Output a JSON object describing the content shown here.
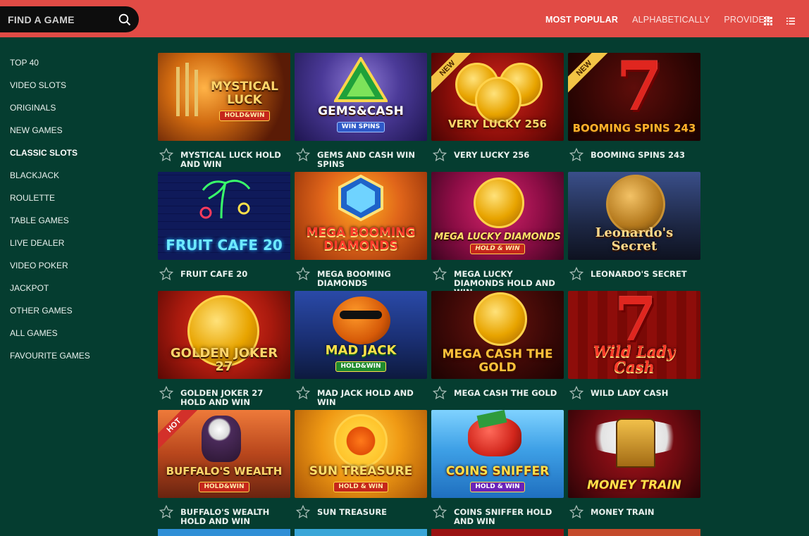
{
  "header": {
    "search_placeholder": "FIND A GAME",
    "sort_tabs": [
      "MOST POPULAR",
      "ALPHABETICALLY",
      "PROVIDER"
    ],
    "active_sort": "MOST POPULAR",
    "view_icons": [
      "grid-view-icon",
      "list-view-icon"
    ]
  },
  "sidebar": {
    "items": [
      "TOP 40",
      "VIDEO SLOTS",
      "ORIGINALS",
      "NEW GAMES",
      "CLASSIC SLOTS",
      "BLACKJACK",
      "ROULETTE",
      "TABLE GAMES",
      "LIVE DEALER",
      "VIDEO POKER",
      "JACKPOT",
      "OTHER GAMES",
      "ALL GAMES",
      "FAVOURITE GAMES"
    ],
    "active": "CLASSIC SLOTS"
  },
  "games": [
    {
      "name": "MYSTICAL LUCK HOLD AND WIN",
      "thumb_title": "MYSTICAL LUCK",
      "thumb_sub": "HOLD&WIN",
      "badge": ""
    },
    {
      "name": "GEMS AND CASH WIN SPINS",
      "thumb_title": "GEMS&CASH",
      "thumb_sub": "WIN SPINS",
      "badge": ""
    },
    {
      "name": "VERY LUCKY 256",
      "thumb_title": "VERY LUCKY 256",
      "thumb_sub": "",
      "badge": "NEW"
    },
    {
      "name": "BOOMING SPINS 243",
      "thumb_title": "BOOMING SPINS 243",
      "thumb_sub": "",
      "badge": "NEW"
    },
    {
      "name": "FRUIT CAFE 20",
      "thumb_title": "FRUIT CAFE 20",
      "thumb_sub": "",
      "badge": ""
    },
    {
      "name": "MEGA BOOMING DIAMONDS",
      "thumb_title": "MEGA BOOMING DIAMONDS",
      "thumb_sub": "",
      "badge": ""
    },
    {
      "name": "MEGA LUCKY DIAMONDS HOLD AND WIN",
      "thumb_title": "MEGA LUCKY DIAMONDS",
      "thumb_sub": "HOLD & WIN",
      "badge": ""
    },
    {
      "name": "LEONARDO'S SECRET",
      "thumb_title": "Leonardo's Secret",
      "thumb_sub": "",
      "badge": ""
    },
    {
      "name": "GOLDEN JOKER 27 HOLD AND WIN",
      "thumb_title": "GOLDEN JOKER 27",
      "thumb_sub": "",
      "badge": ""
    },
    {
      "name": "MAD JACK HOLD AND WIN",
      "thumb_title": "MAD JACK",
      "thumb_sub": "HOLD&WIN",
      "badge": ""
    },
    {
      "name": "MEGA CASH THE GOLD",
      "thumb_title": "MEGA CASH THE GOLD",
      "thumb_sub": "",
      "badge": ""
    },
    {
      "name": "WILD LADY CASH",
      "thumb_title": "Wild Lady Cash",
      "thumb_sub": "",
      "badge": ""
    },
    {
      "name": "BUFFALO'S WEALTH HOLD AND WIN",
      "thumb_title": "BUFFALO'S WEALTH",
      "thumb_sub": "HOLD&WIN",
      "badge": "HOT"
    },
    {
      "name": "SUN TREASURE",
      "thumb_title": "SUN TREASURE",
      "thumb_sub": "HOLD & WIN",
      "badge": ""
    },
    {
      "name": "COINS SNIFFER HOLD AND WIN",
      "thumb_title": "COINS SNIFFER",
      "thumb_sub": "HOLD & WIN",
      "badge": ""
    },
    {
      "name": "MONEY TRAIN",
      "thumb_title": "MONEY TRAIN",
      "thumb_sub": "",
      "badge": ""
    }
  ],
  "colors": {
    "header_bg": "#e14b45",
    "page_bg": "#053d30",
    "search_bg": "#0d0d0d"
  }
}
